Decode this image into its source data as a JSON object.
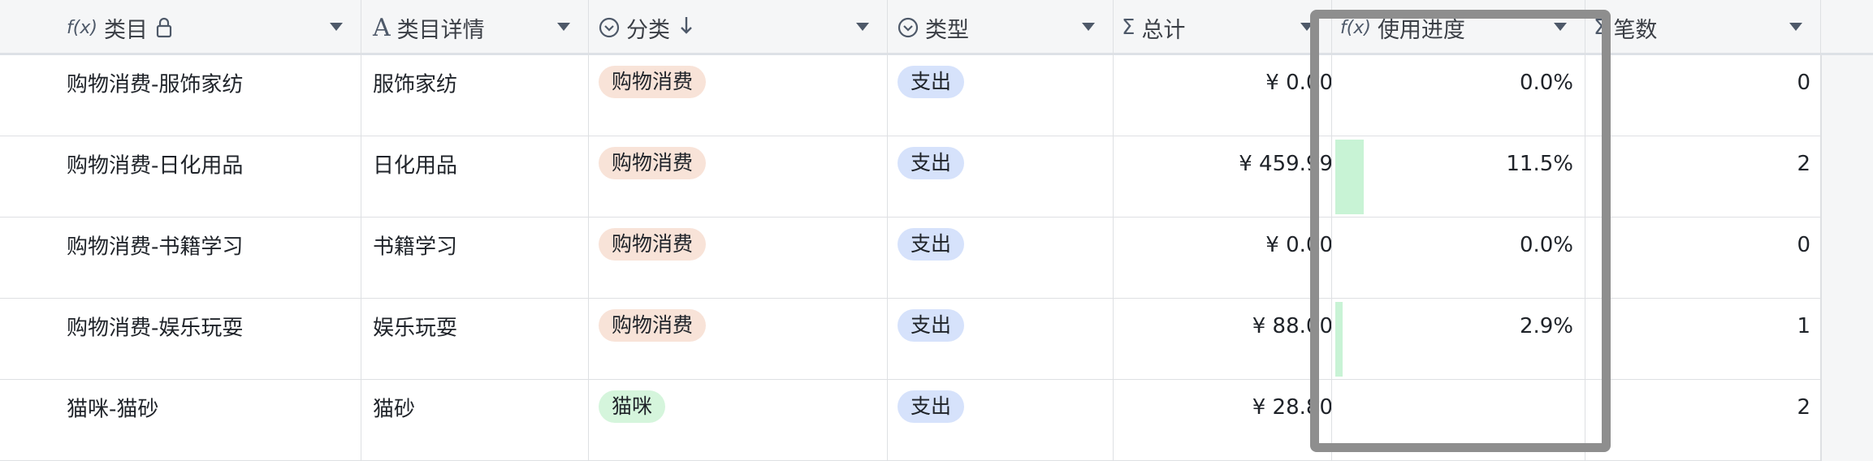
{
  "columns": [
    {
      "key": "category",
      "label": "类目",
      "icon": "formula-icon",
      "icon_text": "f(x)",
      "lock": true
    },
    {
      "key": "detail",
      "label": "类目详情",
      "icon": "text-type-icon",
      "icon_text": "A"
    },
    {
      "key": "group",
      "label": "分类",
      "icon": "single-select-icon",
      "icon_text": "⊙",
      "sorted_desc": true
    },
    {
      "key": "type",
      "label": "类型",
      "icon": "single-select-icon",
      "icon_text": "⊙"
    },
    {
      "key": "total",
      "label": "总计",
      "icon": "sum-icon",
      "icon_text": "Σ"
    },
    {
      "key": "progress",
      "label": "使用进度",
      "icon": "formula-icon",
      "icon_text": "f(x)"
    },
    {
      "key": "count",
      "label": "笔数",
      "icon": "sum-icon",
      "icon_text": "Σ"
    }
  ],
  "rows": [
    {
      "category": "购物消费-服饰家纺",
      "detail": "服饰家纺",
      "group": "购物消费",
      "type": "支出",
      "total": "¥ 0.00",
      "progress": "0.0%",
      "progress_value": 0.0,
      "count": "0"
    },
    {
      "category": "购物消费-日化用品",
      "detail": "日化用品",
      "group": "购物消费",
      "type": "支出",
      "total": "¥ 459.99",
      "progress": "11.5%",
      "progress_value": 0.115,
      "count": "2"
    },
    {
      "category": "购物消费-书籍学习",
      "detail": "书籍学习",
      "group": "购物消费",
      "type": "支出",
      "total": "¥ 0.00",
      "progress": "0.0%",
      "progress_value": 0.0,
      "count": "0"
    },
    {
      "category": "购物消费-娱乐玩耍",
      "detail": "娱乐玩耍",
      "group": "购物消费",
      "type": "支出",
      "total": "¥ 88.00",
      "progress": "2.9%",
      "progress_value": 0.029,
      "count": "1"
    },
    {
      "category": "猫咪-猫砂",
      "detail": "猫砂",
      "group": "猫咪",
      "type": "支出",
      "total": "¥ 28.80",
      "progress": "",
      "progress_value": null,
      "count": "2"
    }
  ],
  "tag_colors": {
    "购物消费": {
      "bg": "#f8e3d8",
      "fg": "#1f2329"
    },
    "猫咪": {
      "bg": "#d5f5dc",
      "fg": "#1f2329"
    },
    "支出": {
      "bg": "#d6e2fb",
      "fg": "#1f2329"
    }
  },
  "colors": {
    "progress_fill": "#c8f3d5",
    "highlight_border": "#8e8e8e"
  }
}
